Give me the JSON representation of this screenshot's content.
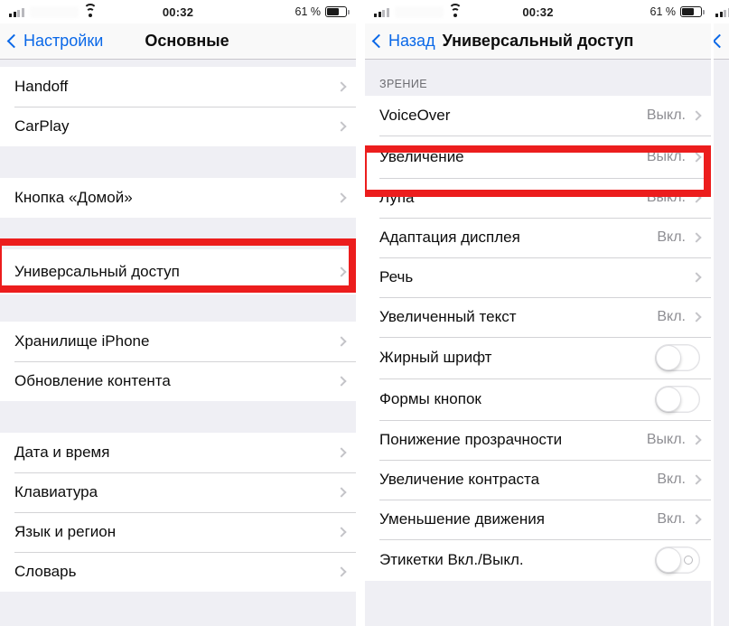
{
  "device": {
    "status_bar": {
      "time": "00:32",
      "battery_percent": "61 %",
      "signal_icon": "cellular-signal-icon",
      "wifi_icon": "wifi-icon",
      "battery_icon": "battery-icon",
      "carrier_redacted": true
    }
  },
  "left_screen": {
    "nav": {
      "back_label": "Настройки",
      "title": "Основные",
      "back_icon": "chevron-left-icon"
    },
    "groups": [
      {
        "header": "",
        "rows": [
          {
            "label": "Handoff",
            "value": "",
            "accessory": "chevron"
          },
          {
            "label": "CarPlay",
            "value": "",
            "accessory": "chevron"
          }
        ]
      },
      {
        "header": "",
        "rows": [
          {
            "label": "Кнопка «Домой»",
            "value": "",
            "accessory": "chevron"
          }
        ]
      },
      {
        "header": "",
        "highlighted": true,
        "rows": [
          {
            "label": "Универсальный доступ",
            "value": "",
            "accessory": "chevron"
          }
        ]
      },
      {
        "header": "",
        "rows": [
          {
            "label": "Хранилище iPhone",
            "value": "",
            "accessory": "chevron"
          },
          {
            "label": "Обновление контента",
            "value": "",
            "accessory": "chevron"
          }
        ]
      },
      {
        "header": "",
        "rows": [
          {
            "label": "Дата и время",
            "value": "",
            "accessory": "chevron"
          },
          {
            "label": "Клавиатура",
            "value": "",
            "accessory": "chevron"
          },
          {
            "label": "Язык и регион",
            "value": "",
            "accessory": "chevron"
          },
          {
            "label": "Словарь",
            "value": "",
            "accessory": "chevron"
          }
        ]
      }
    ]
  },
  "right_screen": {
    "nav": {
      "back_label": "Назад",
      "title": "Универсальный доступ",
      "back_icon": "chevron-left-icon"
    },
    "section_header": "ЗРЕНИЕ",
    "rows": [
      {
        "label": "VoiceOver",
        "value": "Выкл.",
        "accessory": "chevron"
      },
      {
        "label": "Увеличение",
        "value": "Выкл.",
        "accessory": "chevron",
        "highlighted": true
      },
      {
        "label": "Лупа",
        "value": "Выкл.",
        "accessory": "chevron"
      },
      {
        "label": "Адаптация дисплея",
        "value": "Вкл.",
        "accessory": "chevron"
      },
      {
        "label": "Речь",
        "value": "",
        "accessory": "chevron"
      },
      {
        "label": "Увеличенный текст",
        "value": "Вкл.",
        "accessory": "chevron"
      },
      {
        "label": "Жирный шрифт",
        "value": "",
        "accessory": "toggle",
        "toggle_on": false
      },
      {
        "label": "Формы кнопок",
        "value": "",
        "accessory": "toggle",
        "toggle_on": false
      },
      {
        "label": "Понижение прозрачности",
        "value": "Выкл.",
        "accessory": "chevron"
      },
      {
        "label": "Увеличение контраста",
        "value": "Вкл.",
        "accessory": "chevron"
      },
      {
        "label": "Уменьшение движения",
        "value": "Вкл.",
        "accessory": "chevron"
      },
      {
        "label": "Этикетки Вкл./Выкл.",
        "value": "",
        "accessory": "toggle",
        "toggle_on": false,
        "toggle_offmark": true
      }
    ]
  },
  "sliver_screen": {
    "back_icon": "chevron-left-icon",
    "signal_icon": "cellular-signal-icon"
  },
  "colors": {
    "highlight_red": "#ec1d1d",
    "link_blue": "#0a68e8",
    "list_bg": "#efeff4",
    "row_bg": "#ffffff",
    "value_gray": "#8e8e93",
    "separator": "#d3d3d6"
  }
}
